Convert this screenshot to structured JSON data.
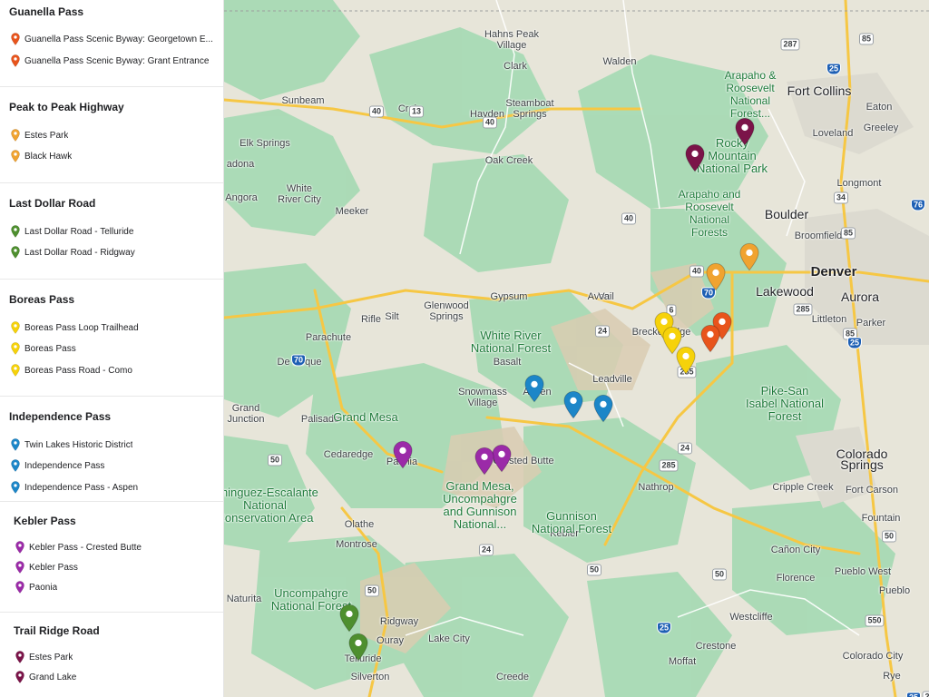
{
  "sidebar": {
    "groups": [
      {
        "title": "Guanella Pass",
        "color": "#e8541c",
        "items": [
          {
            "label": "Guanella Pass Scenic Byway: Georgetown E..."
          },
          {
            "label": "Guanella Pass Scenic Byway: Grant Entrance"
          }
        ]
      },
      {
        "title": "Peak to Peak Highway",
        "color": "#f0a330",
        "items": [
          {
            "label": "Estes Park"
          },
          {
            "label": "Black Hawk"
          }
        ]
      },
      {
        "title": "Last Dollar Road",
        "color": "#4e8f2f",
        "items": [
          {
            "label": "Last Dollar Road - Telluride"
          },
          {
            "label": "Last Dollar Road - Ridgway"
          }
        ]
      },
      {
        "title": "Boreas Pass",
        "color": "#f6d20a",
        "items": [
          {
            "label": "Boreas Pass Loop Trailhead"
          },
          {
            "label": "Boreas Pass"
          },
          {
            "label": "Boreas Pass Road - Como"
          }
        ]
      },
      {
        "title": "Independence Pass",
        "color": "#1c86c8",
        "items": [
          {
            "label": "Twin Lakes Historic District"
          },
          {
            "label": "Independence Pass"
          },
          {
            "label": "Independence Pass - Aspen"
          }
        ]
      },
      {
        "title": "Kebler Pass",
        "color": "#9b2aa8",
        "items": [
          {
            "label": "Kebler Pass - Crested Butte"
          },
          {
            "label": "Kebler Pass"
          },
          {
            "label": "Paonia"
          }
        ]
      },
      {
        "title": "Trail Ridge Road",
        "color": "#7b1449",
        "items": [
          {
            "label": "Estes Park"
          },
          {
            "label": "Grand Lake"
          }
        ]
      }
    ]
  },
  "map": {
    "place_labels": [
      {
        "text": "Hahns Peak\nVillage",
        "class": ""
      },
      {
        "text": "Clark",
        "class": ""
      },
      {
        "text": "Walden",
        "class": ""
      },
      {
        "text": "Steamboat\nSprings",
        "class": ""
      },
      {
        "text": "Sunbeam",
        "class": ""
      },
      {
        "text": "Craig",
        "class": ""
      },
      {
        "text": "Hayden",
        "class": ""
      },
      {
        "text": "Elk Springs",
        "class": ""
      },
      {
        "text": "Oak Creek",
        "class": ""
      },
      {
        "text": "adona",
        "class": ""
      },
      {
        "text": "White\nRiver City",
        "class": ""
      },
      {
        "text": "Angora",
        "class": ""
      },
      {
        "text": "Meeker",
        "class": ""
      },
      {
        "text": "Fort Collins",
        "class": "big"
      },
      {
        "text": "Eaton",
        "class": ""
      },
      {
        "text": "Loveland",
        "class": ""
      },
      {
        "text": "Greeley",
        "class": ""
      },
      {
        "text": "Longmont",
        "class": ""
      },
      {
        "text": "Boulder",
        "class": "big"
      },
      {
        "text": "Broomfield",
        "class": ""
      },
      {
        "text": "Denver",
        "class": "xl"
      },
      {
        "text": "Aurora",
        "class": "big"
      },
      {
        "text": "Lakewood",
        "class": "big"
      },
      {
        "text": "Littleton",
        "class": ""
      },
      {
        "text": "Parker",
        "class": ""
      },
      {
        "text": "Glenwood\nSprings",
        "class": ""
      },
      {
        "text": "Gypsum",
        "class": ""
      },
      {
        "text": "Avon",
        "class": ""
      },
      {
        "text": "Vail",
        "class": ""
      },
      {
        "text": "Rifle",
        "class": ""
      },
      {
        "text": "Silt",
        "class": ""
      },
      {
        "text": "Parachute",
        "class": ""
      },
      {
        "text": "Breckenridge",
        "class": ""
      },
      {
        "text": "De Beque",
        "class": ""
      },
      {
        "text": "Basalt",
        "class": ""
      },
      {
        "text": "Snowmass\nVillage",
        "class": ""
      },
      {
        "text": "Aspen",
        "class": ""
      },
      {
        "text": "Leadville",
        "class": ""
      },
      {
        "text": "Grand\nJunction",
        "class": ""
      },
      {
        "text": "Palisade",
        "class": ""
      },
      {
        "text": "Cedaredge",
        "class": ""
      },
      {
        "text": "Paonia",
        "class": ""
      },
      {
        "text": "Crested Butte",
        "class": ""
      },
      {
        "text": "Nathrop",
        "class": ""
      },
      {
        "text": "Colorado\nSprings",
        "class": "big"
      },
      {
        "text": "Cripple Creek",
        "class": ""
      },
      {
        "text": "Fort Carson",
        "class": ""
      },
      {
        "text": "Fountain",
        "class": ""
      },
      {
        "text": "Olathe",
        "class": ""
      },
      {
        "text": "Kebler",
        "class": ""
      },
      {
        "text": "Montrose",
        "class": ""
      },
      {
        "text": "Cañon City",
        "class": ""
      },
      {
        "text": "Florence",
        "class": ""
      },
      {
        "text": "Pueblo West",
        "class": ""
      },
      {
        "text": "Pueblo",
        "class": ""
      },
      {
        "text": "Naturita",
        "class": ""
      },
      {
        "text": "Ridgway",
        "class": ""
      },
      {
        "text": "Ouray",
        "class": ""
      },
      {
        "text": "Lake City",
        "class": ""
      },
      {
        "text": "Telluride",
        "class": ""
      },
      {
        "text": "Silverton",
        "class": ""
      },
      {
        "text": "Creede",
        "class": ""
      },
      {
        "text": "Moffat",
        "class": ""
      },
      {
        "text": "Westcliffe",
        "class": ""
      },
      {
        "text": "Crestone",
        "class": ""
      },
      {
        "text": "Colorado City",
        "class": ""
      },
      {
        "text": "Rye",
        "class": ""
      }
    ],
    "area_labels": [
      {
        "text": "Arapaho &\nRoosevelt\nNational\nForest..."
      },
      {
        "text": "Rocky\nMountain\nNational Park"
      },
      {
        "text": "Arapaho and\nRoosevelt\nNational\nForests"
      },
      {
        "text": "White River\nNational Forest"
      },
      {
        "text": "Grand Mesa"
      },
      {
        "text": "Grand Mesa,\nUncompahgre\nand Gunnison\nNational..."
      },
      {
        "text": "Gunnison\nNational Forest"
      },
      {
        "text": "Pike-San\nIsabel National\nForest"
      },
      {
        "text": "ominguez-Escalante\nNational\nConservation Area"
      },
      {
        "text": "Uncompahgre\nNational Forest"
      }
    ],
    "road_shields": [
      {
        "text": "287",
        "type": "us"
      },
      {
        "text": "85",
        "type": "us"
      },
      {
        "text": "25",
        "type": "i"
      },
      {
        "text": "40",
        "type": "us"
      },
      {
        "text": "40",
        "type": "us"
      },
      {
        "text": "13",
        "type": "state"
      },
      {
        "text": "40",
        "type": "us"
      },
      {
        "text": "34",
        "type": "us"
      },
      {
        "text": "85",
        "type": "us"
      },
      {
        "text": "76",
        "type": "i"
      },
      {
        "text": "70",
        "type": "i"
      },
      {
        "text": "40",
        "type": "us"
      },
      {
        "text": "6",
        "type": "us"
      },
      {
        "text": "285",
        "type": "us"
      },
      {
        "text": "85",
        "type": "us"
      },
      {
        "text": "25",
        "type": "i"
      },
      {
        "text": "24",
        "type": "us"
      },
      {
        "text": "285",
        "type": "us"
      },
      {
        "text": "70",
        "type": "i"
      },
      {
        "text": "24",
        "type": "us"
      },
      {
        "text": "285",
        "type": "us"
      },
      {
        "text": "50",
        "type": "us"
      },
      {
        "text": "24",
        "type": "us"
      },
      {
        "text": "50",
        "type": "us"
      },
      {
        "text": "50",
        "type": "us"
      },
      {
        "text": "50",
        "type": "us"
      },
      {
        "text": "50",
        "type": "us"
      },
      {
        "text": "25",
        "type": "i"
      },
      {
        "text": "550",
        "type": "us"
      },
      {
        "text": "285",
        "type": "us"
      },
      {
        "text": "25",
        "type": "i"
      }
    ],
    "markers": [
      {
        "group": 6,
        "name": "Estes Park"
      },
      {
        "group": 6,
        "name": "Grand Lake"
      },
      {
        "group": 1,
        "name": "Estes Park"
      },
      {
        "group": 1,
        "name": "Black Hawk"
      },
      {
        "group": 0,
        "name": "Georgetown"
      },
      {
        "group": 0,
        "name": "Grant"
      },
      {
        "group": 3,
        "name": "Boreas Pass Loop Trailhead"
      },
      {
        "group": 3,
        "name": "Boreas Pass"
      },
      {
        "group": 3,
        "name": "Boreas Pass Road - Como"
      },
      {
        "group": 4,
        "name": "Independence Pass - Aspen"
      },
      {
        "group": 4,
        "name": "Independence Pass"
      },
      {
        "group": 4,
        "name": "Twin Lakes Historic District"
      },
      {
        "group": 5,
        "name": "Paonia"
      },
      {
        "group": 5,
        "name": "Kebler Pass"
      },
      {
        "group": 5,
        "name": "Kebler Pass - Crested Butte"
      },
      {
        "group": 2,
        "name": "Last Dollar Road - Ridgway"
      },
      {
        "group": 2,
        "name": "Last Dollar Road - Telluride"
      }
    ],
    "colors": {
      "land": "#e7e5d9",
      "forest": "#a8dab5",
      "forest_dark": "#8fd09f",
      "mountain": "#d9ccb2",
      "road_major": "#f6c744",
      "road_minor": "#ffffff",
      "urban": "#dcdad0"
    }
  }
}
